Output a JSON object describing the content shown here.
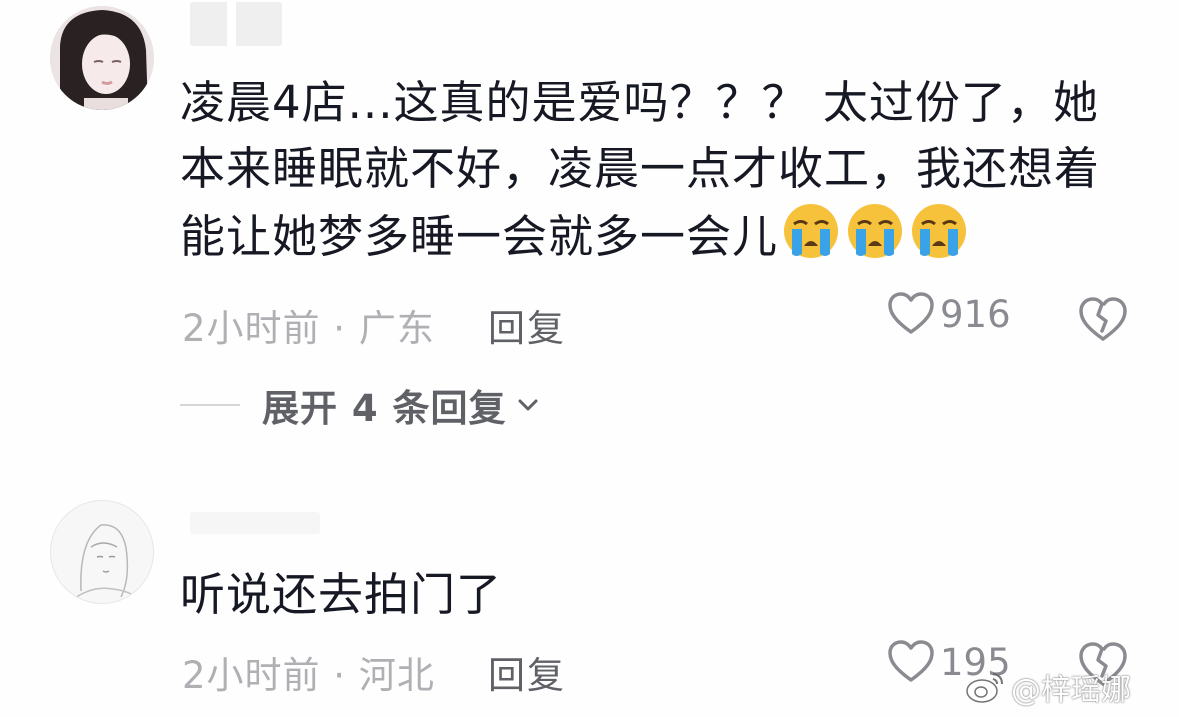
{
  "comments": [
    {
      "text": "凌晨4店...这真的是爱吗？？？ 太过份了，她本来睡眠就不好，凌晨一点才收工，我还想着能让她梦多睡一会就多一会儿",
      "emojis": [
        "crying-face",
        "crying-face",
        "crying-face"
      ],
      "meta": "2小时前 · 广东",
      "reply_label": "回复",
      "likes": "916",
      "expand_label": "展开 4 条回复"
    },
    {
      "text": "听说还去拍门了",
      "meta": "2小时前 · 河北",
      "reply_label": "回复",
      "likes": "195"
    }
  ],
  "watermark": {
    "text": "@梓瑶娜"
  },
  "colors": {
    "text": "#161823",
    "meta": "#b0b0b4",
    "action": "#5f6166",
    "emoji_face": "#f7c23b",
    "emoji_tear": "#3aa3e8"
  },
  "icons": [
    "heart-outline-icon",
    "broken-heart-icon",
    "chevron-down-icon",
    "weibo-logo-icon"
  ]
}
